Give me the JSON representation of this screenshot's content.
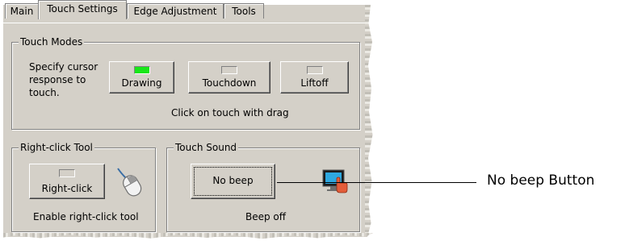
{
  "tabs": [
    {
      "label": "Main",
      "active": false
    },
    {
      "label": "Touch Settings",
      "active": true
    },
    {
      "label": "Edge Adjustment",
      "active": false
    },
    {
      "label": "Tools",
      "active": false
    }
  ],
  "touch_modes": {
    "title": "Touch Modes",
    "description_lines": [
      "Specify cursor",
      "response to",
      "touch."
    ],
    "buttons": [
      {
        "label": "Drawing",
        "led": "on"
      },
      {
        "label": "Touchdown",
        "led": "off"
      },
      {
        "label": "Liftoff",
        "led": "off"
      }
    ],
    "status": "Click on touch with drag"
  },
  "right_click_tool": {
    "title": "Right-click Tool",
    "button_label": "Right-click",
    "icon": "mouse-icon",
    "status": "Enable right-click tool"
  },
  "touch_sound": {
    "title": "Touch Sound",
    "button_label": "No beep",
    "icon": "touch-monitor-icon",
    "status": "Beep off"
  },
  "callout": {
    "label": "No beep Button"
  },
  "colors": {
    "panel": "#d4d0c8",
    "led_on": "#19e619",
    "led_off": "#d4d0c8"
  }
}
